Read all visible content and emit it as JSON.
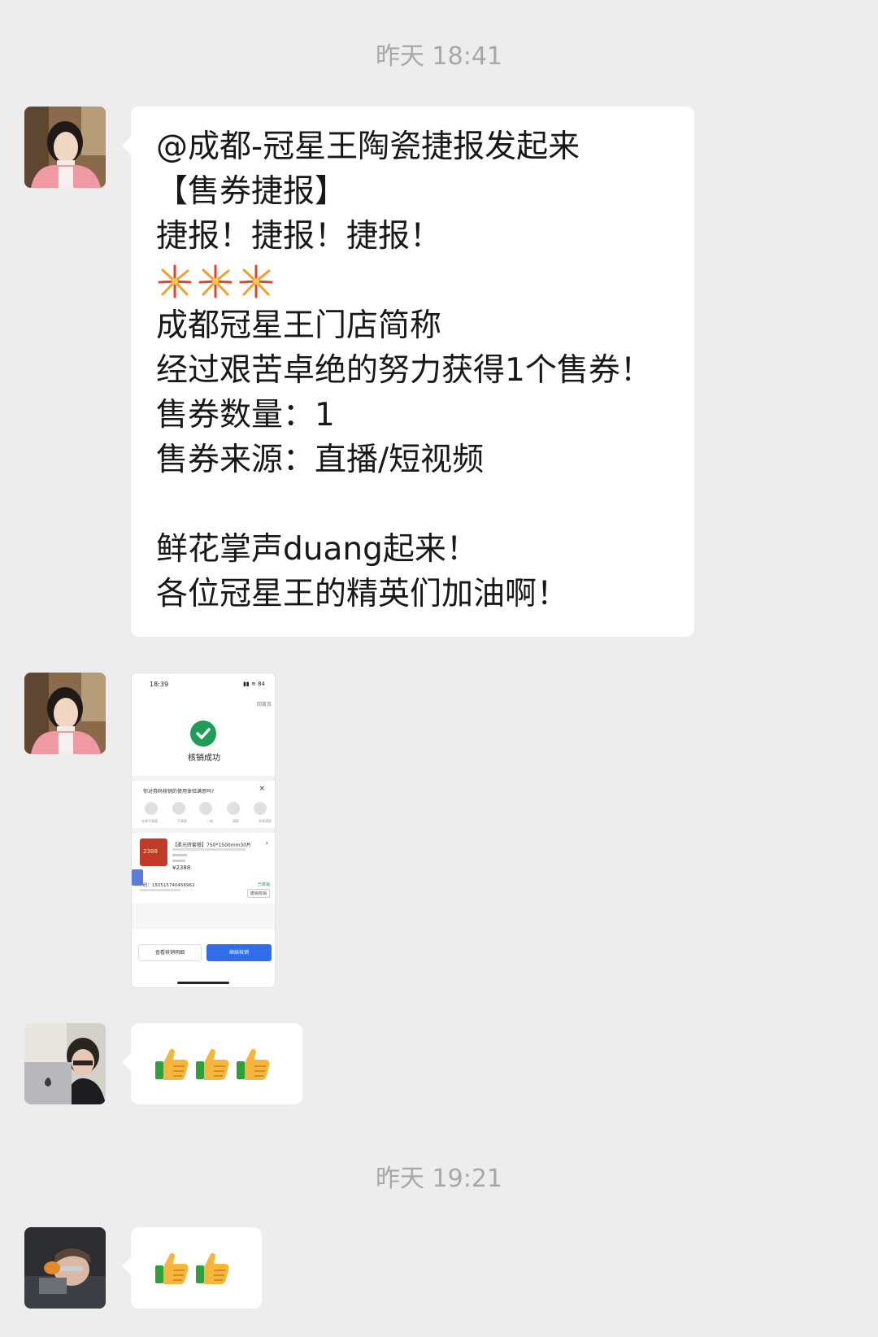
{
  "chat": {
    "divider1": "昨天 18:41",
    "divider2": "昨天 19:21",
    "message1": {
      "lines": [
        "@成都-冠星王陶瓷捷报发起来",
        "【售券捷报】",
        "捷报！捷报！捷报！",
        "",
        "成都冠星王门店简称",
        "经过艰苦卓绝的努力获得1个售券！",
        "售券数量：1",
        "售券来源：直播/短视频",
        "",
        "鲜花掌声duang起来！",
        "各位冠星王的精英们加油啊！"
      ],
      "emoji": "fireworks-icon x3"
    },
    "message2": {
      "status_time": "18:39",
      "status_icons": "▮▮ ≋ 84",
      "home_link": "回首页",
      "success_text": "核销成功",
      "survey_question": "你对券码核销的使用体验满意吗?",
      "survey_close": "×",
      "survey_labels": [
        "非常不满意",
        "不满意",
        "一般",
        "满意",
        "非常满意"
      ],
      "product_badge": "2388",
      "product_title": "【柔光砖套餐】750*1500mm30片",
      "product_arrow": "›",
      "product_price": "¥2388",
      "code_text": "码：1505157404569​62",
      "code_status": "已核销",
      "cancel_button": "撤销核销",
      "view_button": "查看核销明细",
      "continue_button": "继续核销"
    },
    "message3": {
      "emoji": "thumbs-up x3"
    },
    "message4": {
      "emoji": "thumbs-up x2"
    }
  },
  "colors": {
    "background": "#ededed",
    "bubble": "#ffffff",
    "timestamp": "#a8a8a8",
    "success_green": "#1f9d55",
    "primary_blue": "#2f6ee8"
  }
}
